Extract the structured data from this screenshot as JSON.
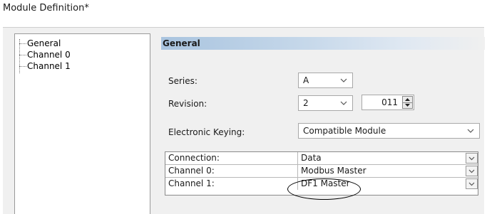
{
  "window": {
    "title": "Module Definition*"
  },
  "tree": {
    "items": [
      {
        "label": "General"
      },
      {
        "label": "Channel 0"
      },
      {
        "label": "Channel 1"
      }
    ]
  },
  "section": {
    "header": "General"
  },
  "fields": {
    "series": {
      "label": "Series:",
      "value": "A"
    },
    "revision": {
      "label": "Revision:",
      "major": "2",
      "minor": "011"
    },
    "keying": {
      "label": "Electronic Keying:",
      "value": "Compatible Module"
    }
  },
  "grid": {
    "rows": [
      {
        "label": "Connection:",
        "value": "Data"
      },
      {
        "label": "Channel 0:",
        "value": "Modbus Master"
      },
      {
        "label": "Channel 1:",
        "value": "DF1 Master"
      }
    ]
  }
}
